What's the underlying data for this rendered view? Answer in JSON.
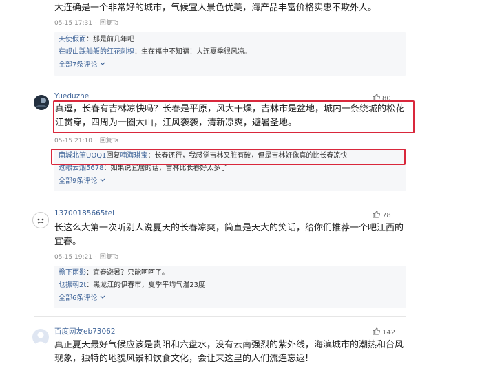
{
  "comment0": {
    "text": "大连确是一个非常好的城市，气候宜人景色优美，海产品丰富价格实惠不欺外人。",
    "time": "05-15 17:31",
    "reply_action": "回复Ta",
    "replies": [
      {
        "user": "天使假面",
        "sep": "：",
        "text": "那是前几年吧"
      },
      {
        "user": "在岘山踩舢舨的红花刺槐",
        "sep": "：",
        "text": "生在福中不知福！大连夏季很风凉。"
      }
    ],
    "expand": "全部7条评论"
  },
  "comment1": {
    "username": "Yueduzhe",
    "likes": "80",
    "text_line1": "真逗，长春有吉林凉快吗？长春是平原，风大干燥，吉林市是盆地，城内一条绕城的松花",
    "text_line2": "江贯穿，四周为一圈大山，江风袭袭，清新凉爽，避暑圣地。",
    "time": "05-15 21:10",
    "reply_action": "回复Ta",
    "replies": [
      {
        "user": "南城北笙UOQ1",
        "mid": "回复",
        "target": "喃海琪宝",
        "sep": "：",
        "text": "长春还行，我感觉吉林又脏有破，但是吉林好像真的比长春凉快"
      },
      {
        "user": "过眼云烟5678",
        "sep": "：",
        "text": "如果说宜居的话，吉林比长春好太多了"
      }
    ],
    "expand": "全部9条评论"
  },
  "comment2": {
    "username": "13700185665tel",
    "likes": "78",
    "text_line1": "长这么大第一次听别人说夏天的长春凉爽，简直是天大的笑话，给你们推荐一个吧江西的",
    "text_line2": "宜春。",
    "time": "05-15 19:21",
    "reply_action": "回复Ta",
    "replies": [
      {
        "user": "檐下雨影",
        "sep": "：",
        "text": "宜春避暑？只能呵呵了。"
      },
      {
        "user": "乜振朝2t",
        "sep": "：",
        "text": "黑龙江的伊春市，夏季平均气温23度"
      }
    ],
    "expand": "全部6条评论"
  },
  "comment3": {
    "username": "百度网友eb73062",
    "likes": "142",
    "text_line1": "真正夏天最好气候应该是贵阳和六盘水，没有云南强烈的紫外线，海滨城市的潮热和台风",
    "text_line2": "现象，独特的地貌风景和饮食文化，会让来这里的人们流连忘返!"
  },
  "colors": {
    "highlight_border": "#d9283c",
    "link": "#406599"
  },
  "icons": {
    "like": "thumbs-up-icon",
    "expand": "chevron-down-icon"
  }
}
